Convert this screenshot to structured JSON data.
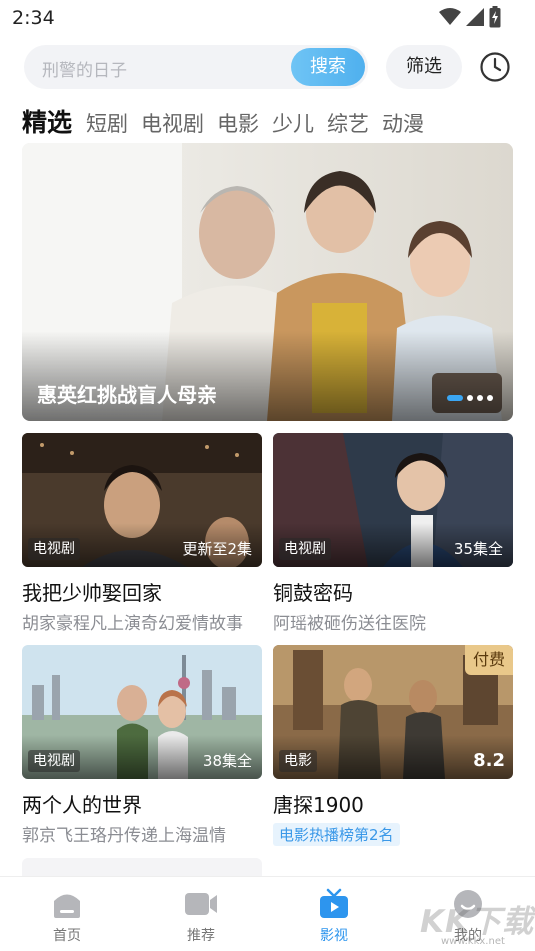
{
  "status_bar": {
    "time": "2:34"
  },
  "search": {
    "placeholder": "刑警的日子",
    "button_label": "搜索"
  },
  "filter": {
    "label": "筛选"
  },
  "history": {
    "icon": "clock-icon"
  },
  "tabs": [
    {
      "label": "精选",
      "active": true
    },
    {
      "label": "短剧"
    },
    {
      "label": "电视剧"
    },
    {
      "label": "电影"
    },
    {
      "label": "少儿"
    },
    {
      "label": "综艺"
    },
    {
      "label": "动漫"
    }
  ],
  "banner": {
    "title": "惠英红挑战盲人母亲",
    "page_count": 4,
    "active_page": 1
  },
  "cards": [
    {
      "type": "电视剧",
      "progress": "更新至2集",
      "title": "我把少帅娶回家",
      "subtitle": "胡家豪程凡上演奇幻爱情故事"
    },
    {
      "type": "电视剧",
      "progress": "35集全",
      "title": "铜鼓密码",
      "subtitle": "阿瑶被砸伤送往医院"
    },
    {
      "type": "电视剧",
      "progress": "38集全",
      "title": "两个人的世界",
      "subtitle": "郭京飞王珞丹传递上海温情"
    },
    {
      "type": "电影",
      "rating": "8.2",
      "paid": "付费",
      "title": "唐探1900",
      "tag": "电影热播榜第2名"
    }
  ],
  "bottom_nav": [
    {
      "label": "首页",
      "icon": "home-icon"
    },
    {
      "label": "推荐",
      "icon": "video-camera-icon"
    },
    {
      "label": "影视",
      "icon": "tv-icon",
      "active": true
    },
    {
      "label": "我的",
      "icon": "profile-icon"
    }
  ],
  "watermark": {
    "text": "KK下载",
    "url": "www.kkx.net"
  },
  "colors": {
    "accent": "#2d95ee",
    "search_button": "#4fb0ee",
    "pay_badge": "#e9c88a"
  }
}
